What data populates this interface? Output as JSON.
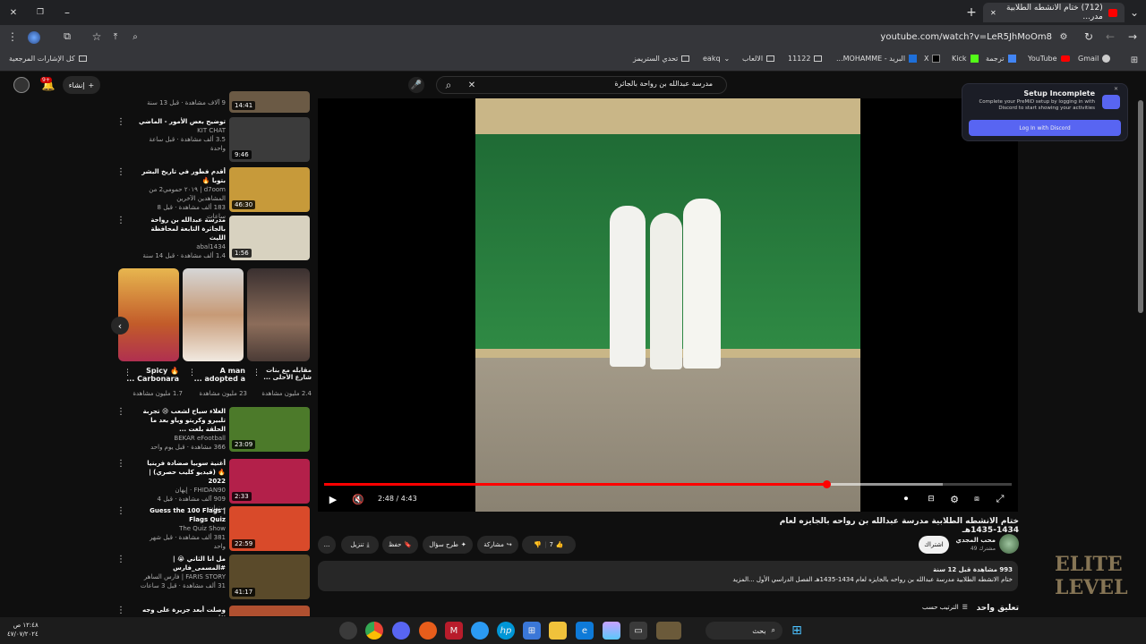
{
  "browser": {
    "tab": {
      "title": "(712) ختام الانشطه الطلابية مدر...",
      "close": "✕"
    },
    "new_tab": "+",
    "url": "youtube.com/watch?v=LeR5JhMoOm8",
    "bookmarks": [
      "Gmail",
      "YouTube",
      "ترجمة",
      "Kick",
      "X",
      "البريد - MOHAMME...",
      "11122",
      "الالعاب",
      "eakq",
      "تحدي الستريمز"
    ],
    "all_bookmarks": "كل الإشارات المرجعية"
  },
  "youtube": {
    "search_value": "مدرسة عبدالله بن رواحة بالجاثرة",
    "create_label": "إنشاء",
    "notif_count": "9+",
    "sidebar": [
      {
        "title": "",
        "channel": "",
        "views": "9 آلاف مشاهدة · قبل 13 سنة",
        "duration": "14:41"
      },
      {
        "title": "توضيح بعض الأمور - الماضي",
        "channel": "KIT CHAT",
        "views": "3.5 ألف مشاهدة · قبل ساعة واحدة",
        "duration": "9:46"
      },
      {
        "title": "أقدم فطور في تاريخ البشر بتوبا 🔥",
        "channel": "d7oom | ٢٠١٩ حمومي2 من المشاهدين الآخرين",
        "views": "183 ألف مشاهدة · قبل 8 ساعات",
        "duration": "46:30"
      },
      {
        "title": "مدرسة عبدالله بن رواحة بالجاثرة التابعة لمحافظة الليث",
        "channel": "abal1434",
        "views": "1.4 ألف مشاهدة · قبل 14 سنة",
        "duration": "1:56"
      }
    ],
    "shorts": [
      {
        "title": "Spicy 🔥 Carbonara ...",
        "views": "1.7 مليون مشاهدة"
      },
      {
        "title": "A man adopted a ...",
        "views": "23 مليون مشاهدة"
      },
      {
        "title": "مقابله مع بنات شارع الأحلى ...",
        "views": "2.4 مليون مشاهدة"
      }
    ],
    "sidebar2": [
      {
        "title": "الغلاء سياح لشعب 😢 تجربة تلبيرو وكريتو وياو بعد ما الحلقة بلغت ...",
        "channel": "BEKAR eFootball",
        "views": "366 مشاهدة · قبل يوم واحد",
        "duration": "23:09"
      },
      {
        "title": "أغنية سوبيا صضادة فرينيا 🔥 (فيديو كليب حصري) | 2022",
        "channel": "FHIDAN90 · إيهان",
        "views": "909 آلف مشاهدة · قبل 4 سنوات",
        "duration": "2:33"
      },
      {
        "title": "Guess the 100 Flags | Flags Quiz",
        "channel": "The Quiz Show",
        "views": "381 ألف مشاهدة · قبل شهر واحد",
        "duration": "22:59"
      },
      {
        "title": "مل انا الثاني 😭 | #المسمى_فارس",
        "channel": "FARIS STORY | فارس الساهر",
        "views": "31 ألف مشاهدة · قبل 3 ساعات",
        "duration": "41:17"
      },
      {
        "title": "وصلت أبعد جزيرة على وجه الأرض...",
        "channel": "",
        "views": "",
        "duration": ""
      }
    ],
    "player": {
      "time": "2:48 / 4:43",
      "progress": 0.73,
      "buffered": 0.9
    },
    "video_title": "ختام الانشطه الطلابية مدرسة عبدالله بن رواحه بالجايزه لعام 1434-1435هـ",
    "channel": {
      "name": "محب المجدي",
      "subs": "49 مشترك",
      "subscribe": "اشتراك"
    },
    "actions": {
      "likes": "7",
      "share": "مشاركة",
      "ask": "طرح سؤال",
      "save": "حفظ",
      "download": "تنزيل",
      "more": "..."
    },
    "description": {
      "stats": "993 مشاهدة قبل 12 سنة",
      "text": "ختام الانشطه الطلابية مدرسة عبدالله بن رواحه بالجايزه لعام 1434-1435هـ الفصل الدراسي الأول ...المزيد"
    },
    "comments": {
      "count": "تعليق واحد",
      "sort": "الترتيب حسب"
    }
  },
  "premid": {
    "title": "Setup Incomplete",
    "body": "Complete your PreMiD setup by logging in with Discord to start showing your activities",
    "button": "Log In with Discord"
  },
  "taskbar": {
    "search": "بحث",
    "time": "١٢:٤٨ ص",
    "date": "٤٧/٠٧/٢٠٢٤"
  },
  "colors": {
    "accent": "#ff0000",
    "discord": "#5865f2"
  }
}
